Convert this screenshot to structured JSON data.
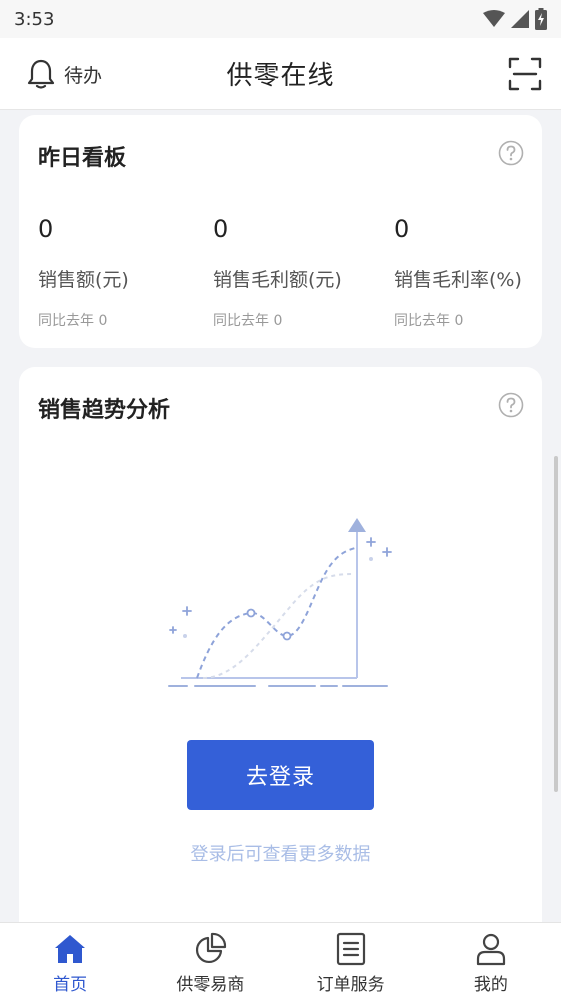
{
  "status_bar": {
    "time": "3:53"
  },
  "header": {
    "todo_label": "待办",
    "title": "供零在线"
  },
  "yesterday_board": {
    "title": "昨日看板",
    "metrics": [
      {
        "value": "0",
        "label": "销售额(元)",
        "compare": "同比去年 0"
      },
      {
        "value": "0",
        "label": "销售毛利额(元)",
        "compare": "同比去年 0"
      },
      {
        "value": "0",
        "label": "销售毛利率(%)",
        "compare": "同比去年 0"
      }
    ]
  },
  "trend": {
    "title": "销售趋势分析",
    "login_button": "去登录",
    "login_hint": "登录后可查看更多数据"
  },
  "tabbar": {
    "items": [
      {
        "label": "首页",
        "icon": "home-icon",
        "active": true
      },
      {
        "label": "供零易商",
        "icon": "pie-chart-icon",
        "active": false
      },
      {
        "label": "订单服务",
        "icon": "document-icon",
        "active": false
      },
      {
        "label": "我的",
        "icon": "user-icon",
        "active": false
      }
    ]
  },
  "colors": {
    "accent": "#3460d8",
    "hint": "#a9bde6",
    "background": "#f2f3f6"
  }
}
